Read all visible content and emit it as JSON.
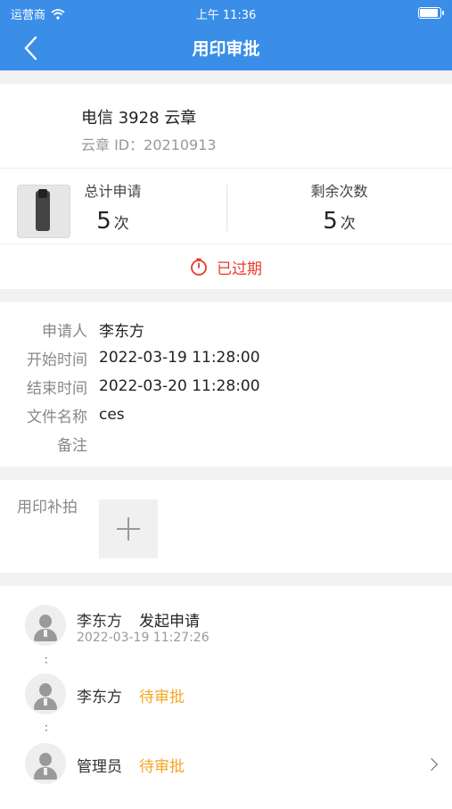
{
  "status_bar": {
    "carrier": "运营商",
    "time": "上午 11:36"
  },
  "nav": {
    "title": "用印审批"
  },
  "device": {
    "name": "电信 3928 云章",
    "id_label": "云章 ID：",
    "id_value": "20210913"
  },
  "stats": {
    "total_label": "总计申请",
    "total_value": "5",
    "total_unit": "次",
    "remaining_label": "剩余次数",
    "remaining_value": "5",
    "remaining_unit": "次"
  },
  "status": {
    "text": "已过期",
    "color": "#e53b2a"
  },
  "info": [
    {
      "label": "申请人",
      "value": "李东方"
    },
    {
      "label": "开始时间",
      "value": "2022-03-19 11:28:00"
    },
    {
      "label": "结束时间",
      "value": "2022-03-20 11:28:00"
    },
    {
      "label": "文件名称",
      "value": "ces"
    },
    {
      "label": "备注",
      "value": ""
    }
  ],
  "photos": {
    "label": "用印补拍"
  },
  "flow": [
    {
      "name": "李东方",
      "action": "发起申请",
      "time": "2022-03-19 11:27:26",
      "action_color": "#222222"
    },
    {
      "name": "李东方",
      "action": "待审批",
      "action_color": "#f5a623"
    },
    {
      "name": "管理员",
      "action": "待审批",
      "action_color": "#f5a623"
    }
  ],
  "colors": {
    "primary": "#3a8ee8",
    "pending": "#f5a623",
    "expired": "#e53b2a"
  }
}
